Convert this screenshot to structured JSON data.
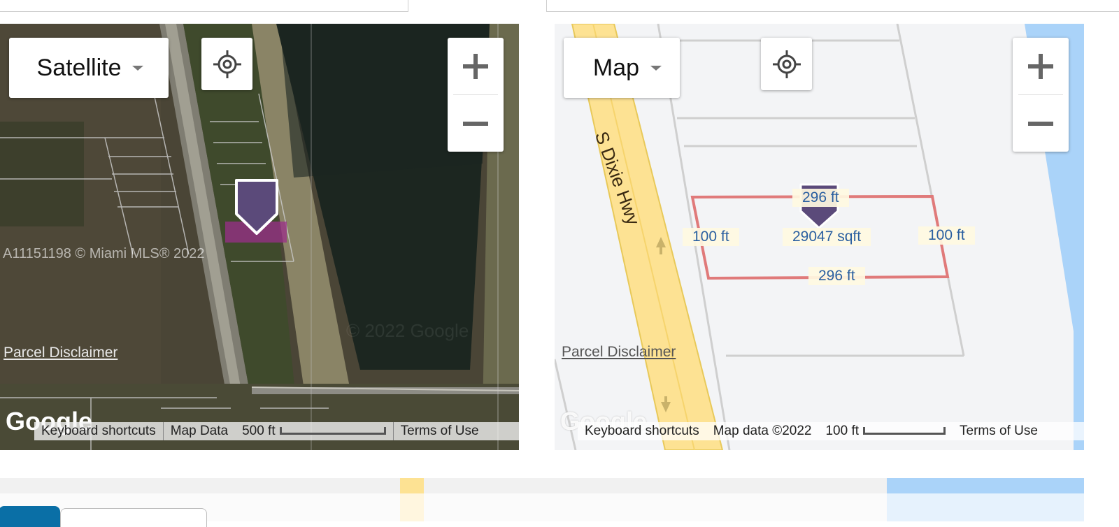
{
  "satellite_map": {
    "map_type_label": "Satellite",
    "watermark": "A11151198 © Miami MLS® 2022",
    "faint_copyright": "© 2022 Google",
    "parcel_disclaimer": "Parcel Disclaimer",
    "google_logo": "Google",
    "attribution": {
      "keyboard_shortcuts": "Keyboard shortcuts",
      "map_data": "Map Data",
      "scale": "500 ft",
      "terms": "Terms of Use"
    }
  },
  "road_map": {
    "map_type_label": "Map",
    "road_name": "S Dixie Hwy",
    "parcel_dimensions": {
      "top": "296 ft",
      "left": "100 ft",
      "area": "29047 sqft",
      "right": "100 ft",
      "bottom": "296 ft"
    },
    "parcel_disclaimer": "Parcel Disclaimer",
    "google_logo": "Google",
    "attribution": {
      "keyboard_shortcuts": "Keyboard shortcuts",
      "map_data": "Map data ©2022",
      "scale": "100 ft",
      "terms": "Terms of Use"
    }
  },
  "colors": {
    "parcel_outline": "#e07a7a",
    "marker": "#5b4a7a",
    "highway": "#fde293",
    "water": "#aad3f9"
  },
  "icons": [
    "locate-icon",
    "zoom-in-icon",
    "zoom-out-icon",
    "map-marker-icon",
    "arrow-up-icon",
    "arrow-down-icon"
  ]
}
